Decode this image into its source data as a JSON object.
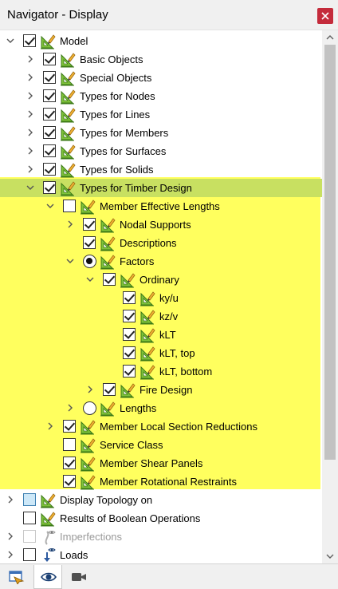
{
  "window": {
    "title": "Navigator - Display"
  },
  "tree": [
    {
      "label": "Model",
      "level": 0,
      "chevron": "down",
      "control": "checked",
      "icon": "model-display-icon"
    },
    {
      "label": "Basic Objects",
      "level": 1,
      "chevron": "right",
      "control": "checked",
      "icon": "model-display-icon"
    },
    {
      "label": "Special Objects",
      "level": 1,
      "chevron": "right",
      "control": "checked",
      "icon": "model-display-icon"
    },
    {
      "label": "Types for Nodes",
      "level": 1,
      "chevron": "right",
      "control": "checked",
      "icon": "model-display-icon"
    },
    {
      "label": "Types for Lines",
      "level": 1,
      "chevron": "right",
      "control": "checked",
      "icon": "model-display-icon"
    },
    {
      "label": "Types for Members",
      "level": 1,
      "chevron": "right",
      "control": "checked",
      "icon": "model-display-icon"
    },
    {
      "label": "Types for Surfaces",
      "level": 1,
      "chevron": "right",
      "control": "checked",
      "icon": "model-display-icon"
    },
    {
      "label": "Types for Solids",
      "level": 1,
      "chevron": "right",
      "control": "checked",
      "icon": "model-display-icon"
    },
    {
      "label": "Types for Timber Design",
      "level": 1,
      "chevron": "down",
      "control": "checked",
      "icon": "model-display-icon",
      "selected": true
    },
    {
      "label": "Member Effective Lengths",
      "level": 2,
      "chevron": "down",
      "control": "unchecked",
      "icon": "model-display-icon"
    },
    {
      "label": "Nodal Supports",
      "level": 3,
      "chevron": "right",
      "control": "checked",
      "icon": "model-display-icon"
    },
    {
      "label": "Descriptions",
      "level": 3,
      "chevron": "none",
      "control": "checked",
      "icon": "model-display-icon"
    },
    {
      "label": "Factors",
      "level": 3,
      "chevron": "down",
      "control": "radio-on",
      "icon": "model-display-icon"
    },
    {
      "label": "Ordinary",
      "level": 4,
      "chevron": "down",
      "control": "checked",
      "icon": "model-display-icon"
    },
    {
      "label": "ky/u",
      "level": 5,
      "chevron": "none",
      "control": "checked",
      "icon": "model-display-icon"
    },
    {
      "label": "kz/v",
      "level": 5,
      "chevron": "none",
      "control": "checked",
      "icon": "model-display-icon"
    },
    {
      "label": "kLT",
      "level": 5,
      "chevron": "none",
      "control": "checked",
      "icon": "model-display-icon"
    },
    {
      "label": "kLT, top",
      "level": 5,
      "chevron": "none",
      "control": "checked",
      "icon": "model-display-icon"
    },
    {
      "label": "kLT, bottom",
      "level": 5,
      "chevron": "none",
      "control": "checked",
      "icon": "model-display-icon"
    },
    {
      "label": "Fire Design",
      "level": 4,
      "chevron": "right",
      "control": "checked",
      "icon": "model-display-icon"
    },
    {
      "label": "Lengths",
      "level": 3,
      "chevron": "right",
      "control": "radio-off",
      "icon": "model-display-icon"
    },
    {
      "label": "Member Local Section Reductions",
      "level": 2,
      "chevron": "right",
      "control": "checked",
      "icon": "model-display-icon"
    },
    {
      "label": "Service Class",
      "level": 2,
      "chevron": "none",
      "control": "unchecked",
      "icon": "model-display-icon"
    },
    {
      "label": "Member Shear Panels",
      "level": 2,
      "chevron": "none",
      "control": "checked",
      "icon": "model-display-icon"
    },
    {
      "label": "Member Rotational Restraints",
      "level": 2,
      "chevron": "none",
      "control": "checked",
      "icon": "model-display-icon"
    },
    {
      "label": "Display Topology on",
      "level": 0,
      "chevron": "right",
      "control": "partial",
      "icon": "model-display-icon"
    },
    {
      "label": "Results of Boolean Operations",
      "level": 0,
      "chevron": "none",
      "control": "unchecked",
      "icon": "model-display-icon"
    },
    {
      "label": "Imperfections",
      "level": 0,
      "chevron": "right",
      "control": "disabled",
      "icon": "imperfections-icon",
      "dim": true
    },
    {
      "label": "Loads",
      "level": 0,
      "chevron": "right",
      "control": "unchecked",
      "icon": "loads-icon"
    }
  ],
  "bottom_tabs": [
    {
      "name": "data-tab",
      "icon": "data-navigator-icon"
    },
    {
      "name": "display-tab",
      "icon": "eye-icon",
      "active": true
    },
    {
      "name": "views-tab",
      "icon": "camera-icon"
    }
  ],
  "colors": {
    "highlight": "#ffff5e",
    "selected": "#c8e061",
    "close_button": "#c42b3b",
    "check_partial": "#cde8f8"
  }
}
